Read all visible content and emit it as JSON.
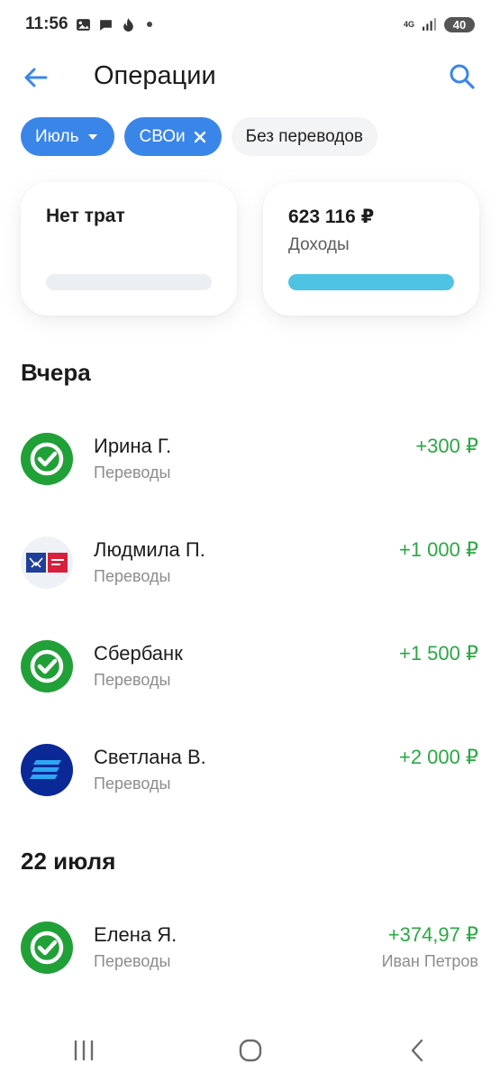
{
  "status_bar": {
    "time": "11:56",
    "network": "4G",
    "battery": "40"
  },
  "header": {
    "title": "Операции"
  },
  "filters": {
    "month": "Июль",
    "tag": "СВОи",
    "transfers": "Без переводов"
  },
  "summary": {
    "spend_label": "Нет трат",
    "spend_level": 0,
    "income_amount": "623 116 ₽",
    "income_label": "Доходы",
    "income_level": 1.0
  },
  "sections": [
    {
      "heading": "Вчера",
      "items": [
        {
          "name": "Ирина Г.",
          "category": "Переводы",
          "amount": "+300 ₽",
          "note": "",
          "icon": "sber-icon"
        },
        {
          "name": "Людмила П.",
          "category": "Переводы",
          "amount": "+1 000 ₽",
          "note": "",
          "icon": "pochta-bank-icon"
        },
        {
          "name": "Сбербанк",
          "category": "Переводы",
          "amount": "+1 500 ₽",
          "note": "",
          "icon": "sber-icon"
        },
        {
          "name": "Светлана В.",
          "category": "Переводы",
          "amount": "+2 000 ₽",
          "note": "",
          "icon": "vtb-icon"
        }
      ]
    },
    {
      "heading": "22 июля",
      "items": [
        {
          "name": "Елена Я.",
          "category": "Переводы",
          "amount": "+374,97 ₽",
          "note": "Иван Петров",
          "icon": "sber-icon"
        }
      ]
    }
  ],
  "colors": {
    "accent": "#3a86e8",
    "income": "#2aa844",
    "sber": "#21a038",
    "vtb": "#0a2896",
    "bar_fill": "#4fc3e3"
  }
}
